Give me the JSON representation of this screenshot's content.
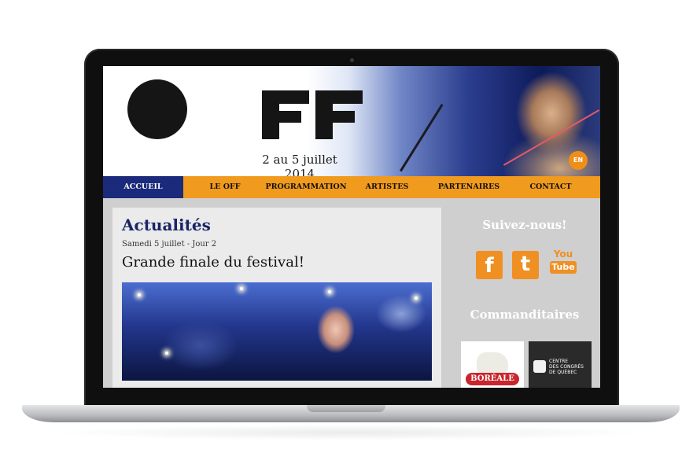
{
  "site": {
    "dates": "2 au 5 juillet 2014",
    "lang_button": "EN"
  },
  "nav": [
    {
      "label": "ACCUEIL",
      "active": true
    },
    {
      "label": "LE OFF",
      "active": false
    },
    {
      "label": "PROGRAMMATION",
      "active": false
    },
    {
      "label": "ARTISTES",
      "active": false
    },
    {
      "label": "PARTENAIRES",
      "active": false
    },
    {
      "label": "CONTACT",
      "active": false
    }
  ],
  "news": {
    "section_title": "Actualités",
    "date_line": "Samedi 5 juillet - Jour 2",
    "headline": "Grande finale du festival!"
  },
  "sidebar": {
    "follow_title": "Suivez-nous!",
    "social": [
      {
        "icon": "facebook-icon",
        "glyph": "f"
      },
      {
        "icon": "twitter-icon",
        "glyph": "t"
      },
      {
        "icon": "youtube-icon",
        "glyph_top": "You",
        "glyph_bottom": "Tube"
      }
    ],
    "sponsors_title": "Commanditaires",
    "sponsors": [
      {
        "name": "BORÉALE"
      },
      {
        "name_lines": [
          "CENTRE",
          "DES CONGRÈS",
          "DE QUÉBEC"
        ]
      }
    ]
  },
  "colors": {
    "nav_orange": "#f09a1e",
    "nav_active": "#1b2a7a",
    "heading_navy": "#1a2466",
    "social_orange": "#f08f22"
  }
}
